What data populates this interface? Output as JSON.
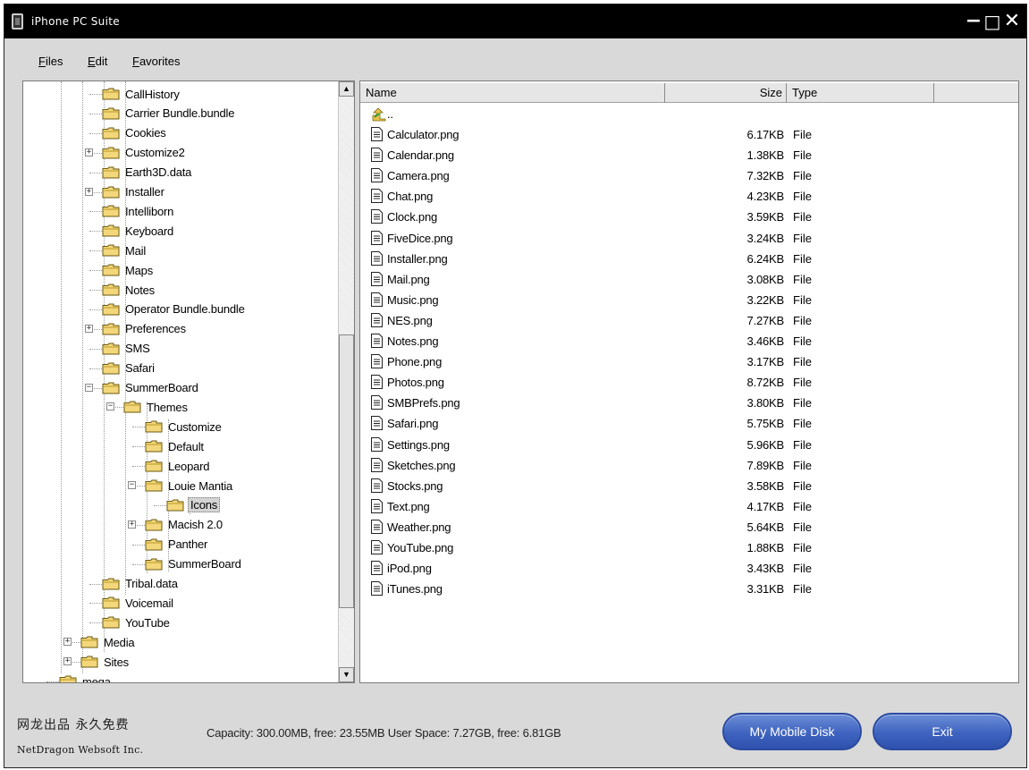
{
  "window": {
    "title": "iPhone PC Suite"
  },
  "menu": [
    {
      "label": "Files",
      "mnemonic": "F"
    },
    {
      "label": "Edit",
      "mnemonic": "E"
    },
    {
      "label": "Favorites",
      "mnemonic": "F"
    }
  ],
  "tree": {
    "items": [
      {
        "label": "CallHistory",
        "expander": ""
      },
      {
        "label": "Carrier Bundle.bundle",
        "expander": ""
      },
      {
        "label": "Cookies",
        "expander": ""
      },
      {
        "label": "Customize2",
        "expander": "+"
      },
      {
        "label": "Earth3D.data",
        "expander": ""
      },
      {
        "label": "Installer",
        "expander": "+"
      },
      {
        "label": "Intelliborn",
        "expander": ""
      },
      {
        "label": "Keyboard",
        "expander": ""
      },
      {
        "label": "Mail",
        "expander": ""
      },
      {
        "label": "Maps",
        "expander": ""
      },
      {
        "label": "Notes",
        "expander": ""
      },
      {
        "label": "Operator Bundle.bundle",
        "expander": ""
      },
      {
        "label": "Preferences",
        "expander": "+"
      },
      {
        "label": "SMS",
        "expander": ""
      },
      {
        "label": "Safari",
        "expander": ""
      },
      {
        "label": "SummerBoard",
        "expander": "-"
      },
      {
        "label": "Themes",
        "expander": "-"
      },
      {
        "label": "Customize",
        "expander": ""
      },
      {
        "label": "Default",
        "expander": ""
      },
      {
        "label": "Leopard",
        "expander": ""
      },
      {
        "label": "Louie Mantia",
        "expander": "-"
      },
      {
        "label": "Icons",
        "expander": "",
        "selected": true
      },
      {
        "label": "Macish 2.0",
        "expander": "+"
      },
      {
        "label": "Panther",
        "expander": ""
      },
      {
        "label": "SummerBoard",
        "expander": ""
      },
      {
        "label": "Tribal.data",
        "expander": ""
      },
      {
        "label": "Voicemail",
        "expander": ""
      },
      {
        "label": "YouTube",
        "expander": ""
      },
      {
        "label": "Media",
        "expander": "+"
      },
      {
        "label": "Sites",
        "expander": "+"
      },
      {
        "label": "mega",
        "expander": ""
      }
    ]
  },
  "files": {
    "columns": {
      "name": "Name",
      "size": "Size",
      "type": "Type"
    },
    "parent_label": "..",
    "rows": [
      {
        "name": "Calculator.png",
        "size": "6.17KB",
        "type": "File"
      },
      {
        "name": "Calendar.png",
        "size": "1.38KB",
        "type": "File"
      },
      {
        "name": "Camera.png",
        "size": "7.32KB",
        "type": "File"
      },
      {
        "name": "Chat.png",
        "size": "4.23KB",
        "type": "File"
      },
      {
        "name": "Clock.png",
        "size": "3.59KB",
        "type": "File"
      },
      {
        "name": "FiveDice.png",
        "size": "3.24KB",
        "type": "File"
      },
      {
        "name": "Installer.png",
        "size": "6.24KB",
        "type": "File"
      },
      {
        "name": "Mail.png",
        "size": "3.08KB",
        "type": "File"
      },
      {
        "name": "Music.png",
        "size": "3.22KB",
        "type": "File"
      },
      {
        "name": "NES.png",
        "size": "7.27KB",
        "type": "File"
      },
      {
        "name": "Notes.png",
        "size": "3.46KB",
        "type": "File"
      },
      {
        "name": "Phone.png",
        "size": "3.17KB",
        "type": "File"
      },
      {
        "name": "Photos.png",
        "size": "8.72KB",
        "type": "File"
      },
      {
        "name": "SMBPrefs.png",
        "size": "3.80KB",
        "type": "File"
      },
      {
        "name": "Safari.png",
        "size": "5.75KB",
        "type": "File"
      },
      {
        "name": "Settings.png",
        "size": "5.96KB",
        "type": "File"
      },
      {
        "name": "Sketches.png",
        "size": "7.89KB",
        "type": "File"
      },
      {
        "name": "Stocks.png",
        "size": "3.58KB",
        "type": "File"
      },
      {
        "name": "Text.png",
        "size": "4.17KB",
        "type": "File"
      },
      {
        "name": "Weather.png",
        "size": "5.64KB",
        "type": "File"
      },
      {
        "name": "YouTube.png",
        "size": "1.88KB",
        "type": "File"
      },
      {
        "name": "iPod.png",
        "size": "3.43KB",
        "type": "File"
      },
      {
        "name": "iTunes.png",
        "size": "3.31KB",
        "type": "File"
      }
    ]
  },
  "status": {
    "brand_cn": "网龙出品  永久免费",
    "brand_en": "NetDragon Websoft Inc.",
    "capacity": "Capacity: 300.00MB, free: 23.55MB  User Space: 7.27GB, free: 6.81GB"
  },
  "buttons": {
    "mobile_disk": "My Mobile Disk",
    "exit": "Exit"
  },
  "colors": {
    "titlebar": "#000000",
    "window_bg": "#d9d9d9",
    "button_blue": "#3e63c0",
    "folder_yellow": "#f3d77a"
  }
}
